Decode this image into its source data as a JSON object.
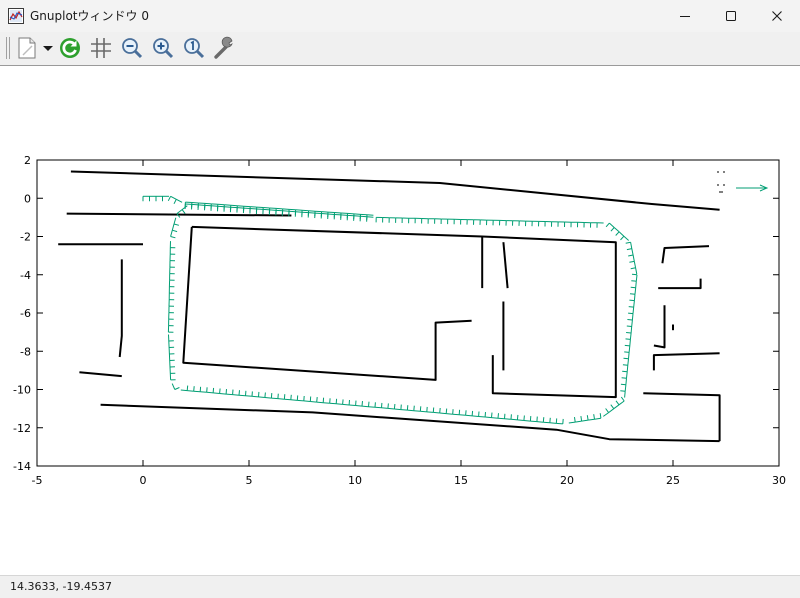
{
  "window": {
    "title": "Gnuplotウィンドウ 0",
    "buttons": [
      "minimize",
      "maximize",
      "close"
    ]
  },
  "toolbar": {
    "items": [
      "copy-menu-icon",
      "dropdown-arrow-icon",
      "replot-icon",
      "grid-icon",
      "zoom-previous-icon",
      "zoom-next-icon",
      "autoscale-icon",
      "options-wrench-icon"
    ]
  },
  "colors": {
    "trajectory": "#009e73",
    "map": "#000000"
  },
  "chart_data": {
    "type": "scatter",
    "title": "",
    "xlabel": "",
    "ylabel": "",
    "xlim": [
      -5,
      30
    ],
    "ylim": [
      -14,
      2
    ],
    "xticks": [
      "-5",
      "0",
      "5",
      "10",
      "15",
      "20",
      "25",
      "30"
    ],
    "yticks": [
      "2",
      "0",
      "-2",
      "-4",
      "-6",
      "-8",
      "-10",
      "-12",
      "-14"
    ],
    "grid": false,
    "legend": "top-right",
    "series": [
      {
        "kind": "map-walls",
        "color": "#000000",
        "polylines": [
          [
            [
              -3.4,
              1.4
            ],
            [
              14.0,
              0.8
            ],
            [
              24.0,
              -0.3
            ],
            [
              27.2,
              -0.6
            ]
          ],
          [
            [
              -3.6,
              -0.8
            ],
            [
              7.0,
              -0.9
            ]
          ],
          [
            [
              -4.0,
              -2.4
            ],
            [
              0.0,
              -2.4
            ]
          ],
          [
            [
              2.3,
              -1.5
            ],
            [
              16.0,
              -2.0
            ],
            [
              22.3,
              -2.3
            ],
            [
              22.3,
              -10.4
            ],
            [
              16.5,
              -10.2
            ],
            [
              16.5,
              -8.2
            ]
          ],
          [
            [
              2.3,
              -1.5
            ],
            [
              1.9,
              -8.6
            ],
            [
              13.8,
              -9.5
            ],
            [
              13.8,
              -6.5
            ],
            [
              15.5,
              -6.4
            ]
          ],
          [
            [
              16.0,
              -2.0
            ],
            [
              16.0,
              -4.7
            ]
          ],
          [
            [
              17.0,
              -2.3
            ],
            [
              17.2,
              -4.7
            ]
          ],
          [
            [
              17.0,
              -5.4
            ],
            [
              17.0,
              -9.0
            ]
          ],
          [
            [
              -2.0,
              -10.8
            ],
            [
              8.0,
              -11.2
            ],
            [
              19.5,
              -12.1
            ],
            [
              22.0,
              -12.6
            ],
            [
              27.2,
              -12.7
            ]
          ],
          [
            [
              27.2,
              -12.7
            ],
            [
              27.2,
              -10.3
            ],
            [
              23.6,
              -10.2
            ]
          ],
          [
            [
              24.1,
              -9.0
            ],
            [
              24.1,
              -8.2
            ],
            [
              27.2,
              -8.1
            ]
          ],
          [
            [
              24.1,
              -7.7
            ],
            [
              24.6,
              -7.8
            ],
            [
              24.6,
              -5.6
            ]
          ],
          [
            [
              25.0,
              -6.6
            ],
            [
              25.0,
              -6.9
            ]
          ],
          [
            [
              24.3,
              -4.7
            ],
            [
              26.3,
              -4.7
            ],
            [
              26.3,
              -4.2
            ]
          ],
          [
            [
              24.5,
              -3.4
            ],
            [
              24.6,
              -2.6
            ],
            [
              26.7,
              -2.5
            ]
          ],
          [
            [
              -3.0,
              -9.1
            ],
            [
              -1.0,
              -9.3
            ]
          ],
          [
            [
              -1.1,
              -8.3
            ],
            [
              -1.0,
              -7.2
            ],
            [
              -1.0,
              -3.2
            ]
          ]
        ]
      },
      {
        "kind": "trajectory-arrows",
        "color": "#009e73",
        "path": [
          [
            0.0,
            0.1
          ],
          [
            1.3,
            0.1
          ],
          [
            2.0,
            -0.3
          ],
          [
            11.0,
            -1.0
          ],
          [
            22.0,
            -1.3
          ],
          [
            23.0,
            -2.3
          ],
          [
            23.3,
            -4.0
          ],
          [
            22.7,
            -10.6
          ],
          [
            21.6,
            -11.5
          ],
          [
            19.8,
            -11.8
          ],
          [
            1.5,
            -10.0
          ],
          [
            1.3,
            -9.5
          ],
          [
            1.2,
            -7.0
          ],
          [
            1.3,
            -2.0
          ],
          [
            1.6,
            -0.8
          ],
          [
            2.2,
            -0.3
          ]
        ],
        "extra": [
          [
            2.0,
            -0.2
          ],
          [
            11.0,
            -0.9
          ]
        ]
      }
    ]
  },
  "status": {
    "coords": "14.3633, -19.4537"
  }
}
